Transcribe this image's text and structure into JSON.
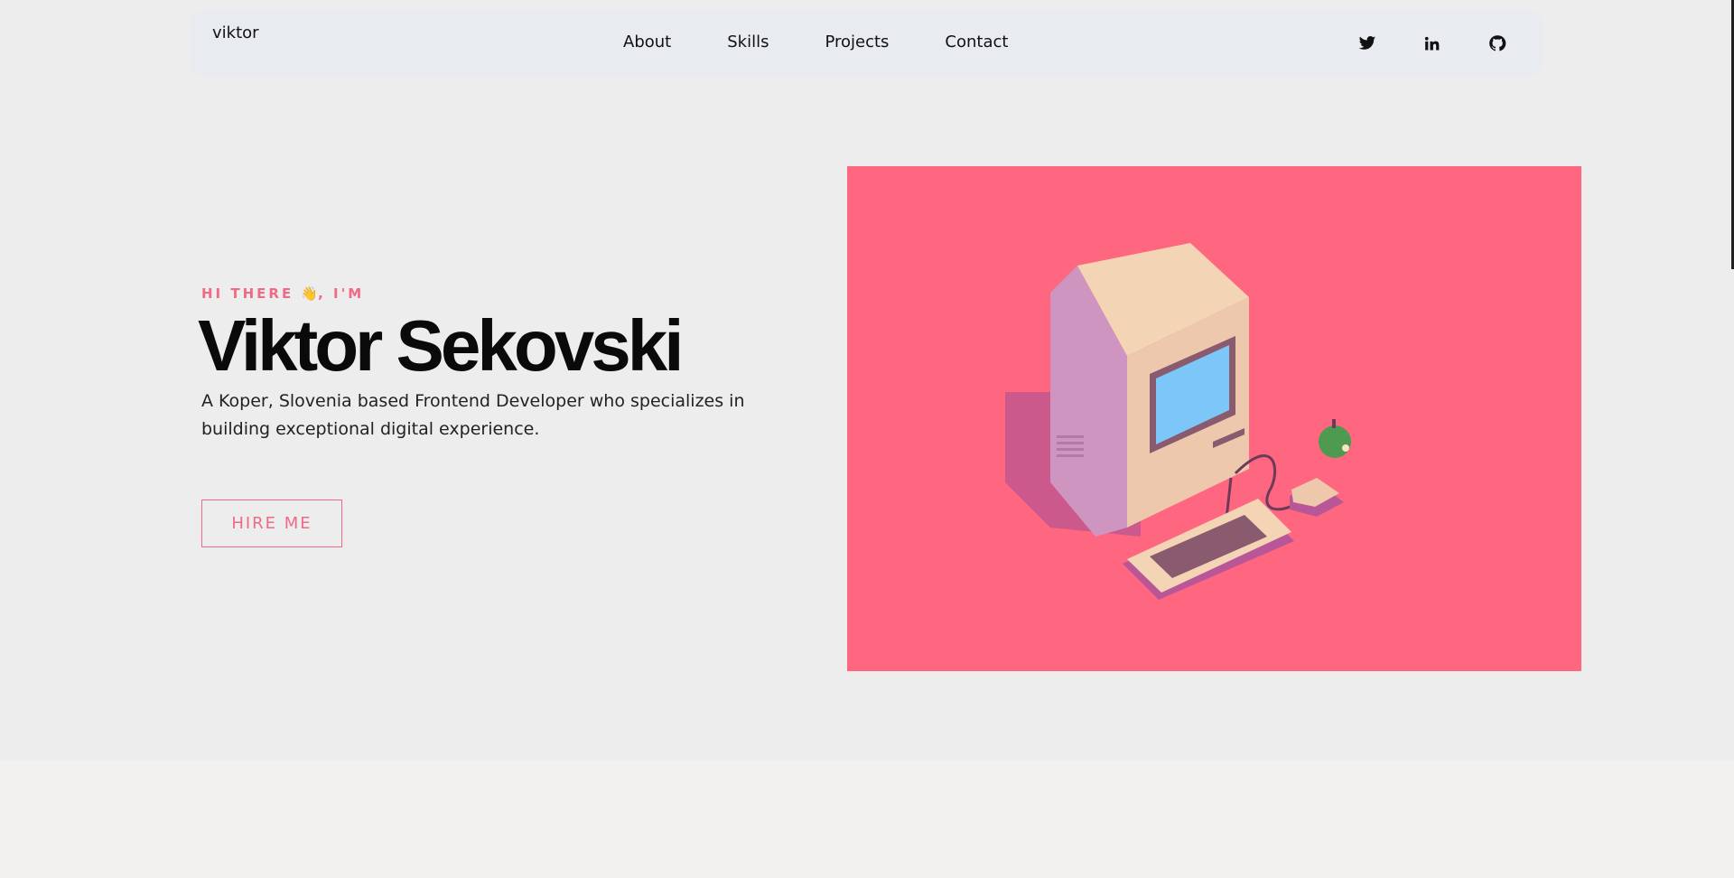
{
  "nav": {
    "logo": "viktor",
    "links": [
      {
        "label": "About"
      },
      {
        "label": "Skills"
      },
      {
        "label": "Projects"
      },
      {
        "label": "Contact"
      }
    ],
    "socials": [
      {
        "icon": "twitter-icon"
      },
      {
        "icon": "linkedin-icon"
      },
      {
        "icon": "github-icon"
      }
    ]
  },
  "hero": {
    "greeting_before": "HI THERE ",
    "greeting_emoji": "👋",
    "greeting_after": ", I'M",
    "name": "Viktor Sekovski",
    "description": "A Koper, Slovenia based Frontend Developer who specializes in building exceptional digital experience.",
    "cta_label": "HIRE ME"
  },
  "colors": {
    "accent": "#ef6a85",
    "panel": "#ff6680",
    "background": "#ededed",
    "navbar": "#e8ebef"
  }
}
